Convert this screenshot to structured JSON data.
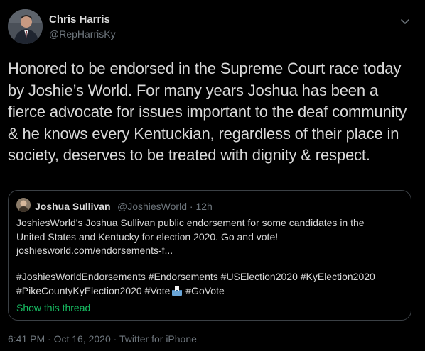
{
  "author": {
    "name": "Chris Harris",
    "handle": "@RepHarrisKy"
  },
  "tweet_text": "Honored to be endorsed in the Supreme Court race today by Joshie’s World. For many years Joshua has been a fierce advocate for issues important to the deaf community & he knows every Kentuckian, regardless of their place in society, deserves to be treated with dignity & respect.",
  "quote": {
    "name": "Joshua Sullivan",
    "handle": "@JoshiesWorld",
    "separator": "·",
    "time": "12h",
    "body_line1": "JoshiesWorld's Joshua Sullivan public endorsement for some candidates in the",
    "body_line2": "United States and Kentucky for election 2020. Go and vote!",
    "body_line3": "joshiesworld.com/endorsements-f...",
    "tags_line1": "#JoshiesWorldEndorsements #Endorsements #USElection2020 #KyElection2020",
    "tags_line2_a": "#PikeCountyKyElection2020 #Vote",
    "tags_line2_b": "#GoVote",
    "show_thread": "Show this thread"
  },
  "footer": {
    "time": "6:41 PM",
    "date": "Oct 16, 2020",
    "source": "Twitter for iPhone",
    "separator": "·"
  },
  "icons": {
    "caret": "chevron-down-icon",
    "ballot": "ballot-box-emoji"
  },
  "colors": {
    "background": "#000000",
    "text": "#d9d9d9",
    "muted": "#6e767d",
    "link_green": "#17bf63",
    "border": "#3b4045"
  }
}
